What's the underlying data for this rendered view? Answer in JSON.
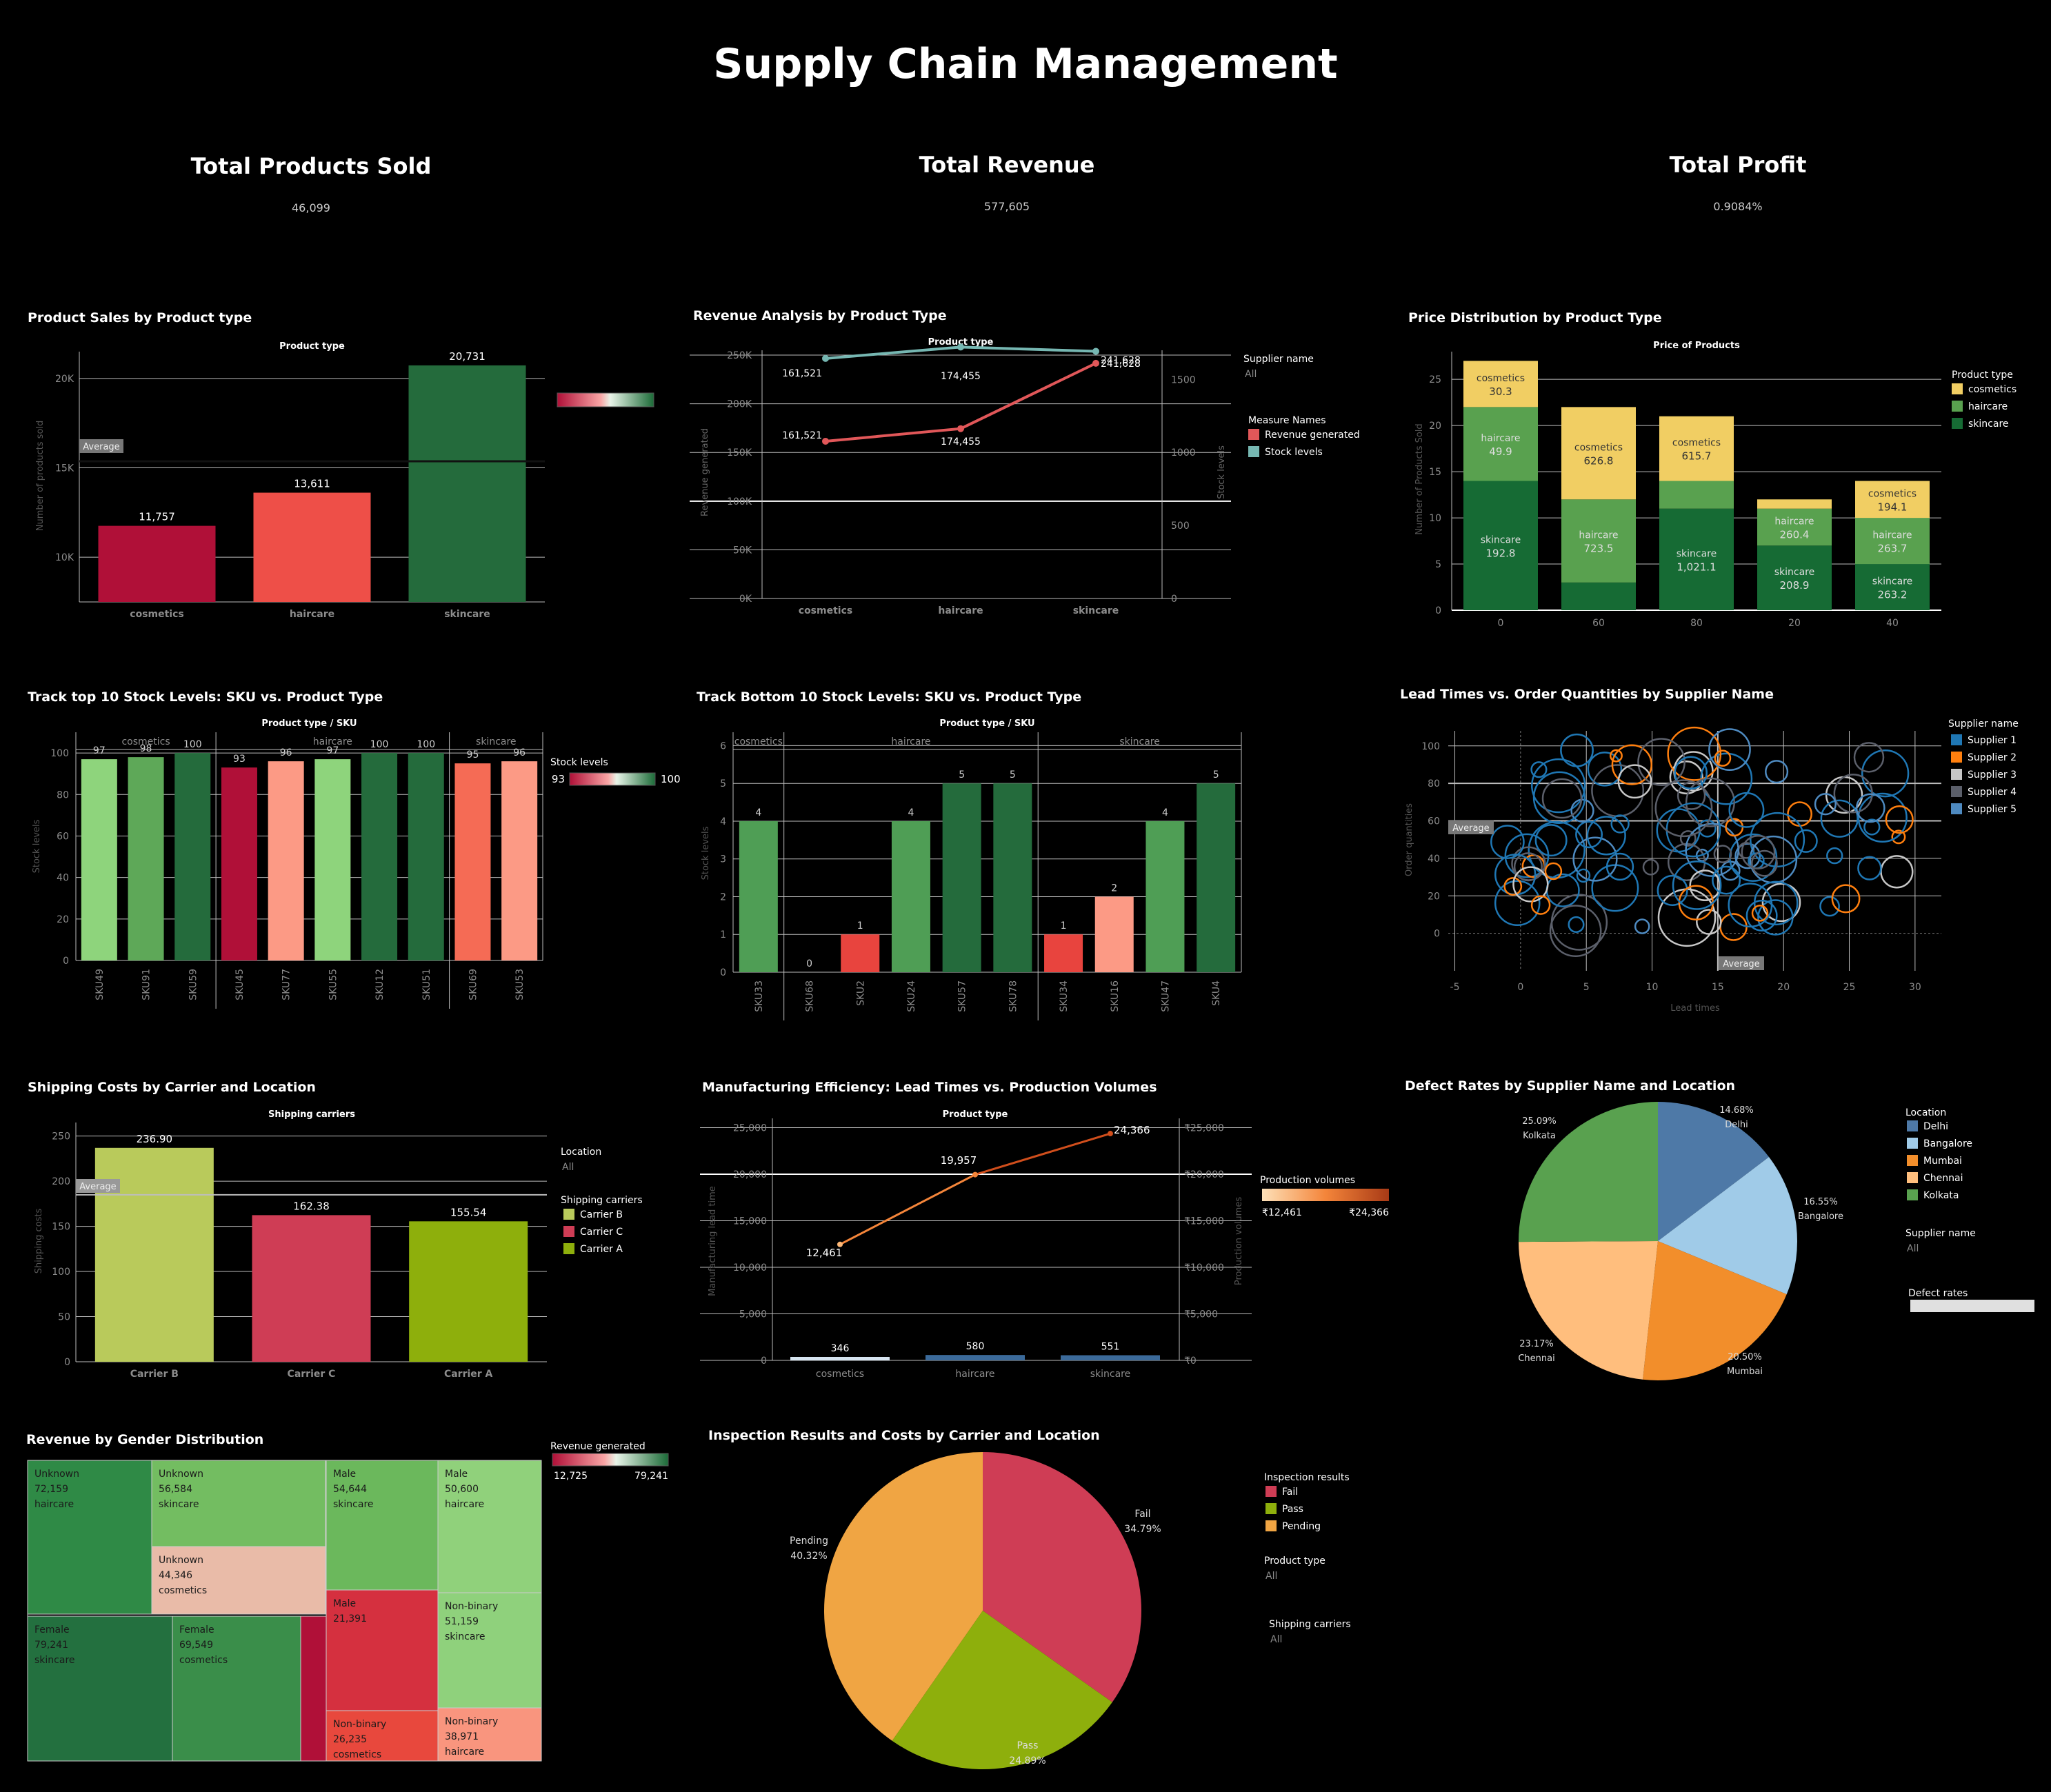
{
  "page_title": "Supply Chain Management",
  "kpis": [
    {
      "title": "Total Products Sold",
      "value": "46,099"
    },
    {
      "title": "Total Revenue",
      "value": "577,605"
    },
    {
      "title": "Total Profit",
      "value": "0.9084%"
    }
  ],
  "chart_data": [
    {
      "id": "product_sales",
      "type": "bar",
      "title": "Product Sales by Product type",
      "header": "Product type",
      "ylabel": "Number of products sold",
      "categories": [
        "cosmetics",
        "haircare",
        "skincare"
      ],
      "values": [
        11757,
        13611,
        20731
      ],
      "value_labels": [
        "11,757",
        "13,611",
        "20,731"
      ],
      "colors": [
        "#b01038",
        "#ee4f48",
        "#246b3c"
      ],
      "yticks": [
        "10K",
        "15K",
        "20K"
      ],
      "ylim": [
        7500,
        21500
      ],
      "reference_line": {
        "label": "Average",
        "value": 15366
      },
      "legend": "color-gradient"
    },
    {
      "id": "revenue_analysis",
      "type": "line",
      "title": "Revenue Analysis by Product Type",
      "header": "Product type",
      "ylabel": "Revenue generated",
      "y2label": "Stock levels",
      "categories": [
        "cosmetics",
        "haircare",
        "skincare"
      ],
      "series": [
        {
          "name": "Revenue generated",
          "color": "#e15759",
          "values": [
            161521,
            174455,
            241628
          ],
          "labels": [
            "161,521",
            "174,455",
            "241,628"
          ]
        },
        {
          "name": "Stock levels",
          "color": "#76b7b2",
          "axis": "right",
          "values": [
            1644,
            1722,
            1693
          ],
          "labels": [
            "161,521",
            "174,455",
            "241,628"
          ]
        }
      ],
      "yticks": [
        "0K",
        "50K",
        "100K",
        "150K",
        "200K",
        "250K"
      ],
      "ylim": [
        0,
        255000
      ],
      "y2ticks": [
        "0",
        "500",
        "1000",
        "1500"
      ],
      "y2lim": [
        0,
        1700
      ],
      "filters": [
        {
          "label": "Supplier name",
          "value": "All"
        }
      ],
      "legend_title": "Measure Names"
    },
    {
      "id": "price_distribution",
      "type": "bar",
      "stacked": true,
      "title": "Price Distribution by Product Type",
      "header": "Price of Products",
      "ylabel": "Number of Products Sold",
      "categories": [
        "0",
        "60",
        "80",
        "20",
        "40"
      ],
      "series": [
        {
          "name": "skincare",
          "color": "#166b34",
          "values": [
            14,
            3,
            11,
            7,
            5
          ],
          "labels": [
            "192.8",
            "",
            "1,021.1",
            "208.9",
            "263.2"
          ]
        },
        {
          "name": "haircare",
          "color": "#59a14f",
          "values": [
            8,
            9,
            3,
            4,
            5
          ],
          "labels": [
            "49.9",
            "723.5",
            "",
            "260.4",
            "263.7"
          ]
        },
        {
          "name": "cosmetics",
          "color": "#f1ce63",
          "values": [
            5,
            10,
            7,
            1,
            4
          ],
          "labels": [
            "30.3",
            "626.8",
            "615.7",
            "",
            "194.1"
          ]
        }
      ],
      "stack_label_names": {
        "skincare": [
          "skincare",
          "",
          "skincare",
          "skincare",
          "skincare"
        ],
        "haircare": [
          "haircare",
          "haircare",
          "",
          "haircare",
          "haircare"
        ],
        "cosmetics": [
          "cosmetics",
          "cosmetics",
          "cosmetics",
          "",
          "cosmetics"
        ]
      },
      "yticks": [
        "0",
        "5",
        "10",
        "15",
        "20",
        "25"
      ],
      "ylim": [
        0,
        28
      ],
      "legend_title": "Product type",
      "legend": [
        "cosmetics",
        "haircare",
        "skincare"
      ]
    },
    {
      "id": "top10_stock",
      "type": "bar",
      "title": "Track top 10 Stock Levels: SKU vs. Product Type",
      "header": "Product type  /  SKU",
      "ylabel": "Stock levels",
      "groups": [
        {
          "name": "cosmetics",
          "skus": [
            "SKU49",
            "SKU91",
            "SKU59"
          ],
          "values": [
            97,
            98,
            100
          ]
        },
        {
          "name": "haircare",
          "skus": [
            "SKU45",
            "SKU77",
            "SKU55",
            "SKU12",
            "SKU51"
          ],
          "values": [
            93,
            96,
            97,
            100,
            100
          ]
        },
        {
          "name": "skincare",
          "skus": [
            "SKU69",
            "SKU53"
          ],
          "values": [
            95,
            96
          ]
        }
      ],
      "colors": [
        "#8ed47c",
        "#5ea858",
        "#246b3c",
        "#b01038",
        "#fc9a85",
        "#8ed47c",
        "#246b3c",
        "#246b3c",
        "#f56b55",
        "#fc9a85"
      ],
      "yticks": [
        "0",
        "20",
        "40",
        "60",
        "80",
        "100"
      ],
      "ylim": [
        0,
        110
      ],
      "legend_title": "Stock levels",
      "legend_min": "93",
      "legend_max": "100"
    },
    {
      "id": "bottom10_stock",
      "type": "bar",
      "title": "Track Bottom 10 Stock Levels: SKU vs. Product Type",
      "header": "Product type  /  SKU",
      "ylabel": "Stock levels",
      "groups": [
        {
          "name": "cosmetics",
          "skus": [
            "SKU33"
          ],
          "values": [
            4
          ]
        },
        {
          "name": "haircare",
          "skus": [
            "SKU68",
            "SKU2",
            "SKU24",
            "SKU57",
            "SKU78"
          ],
          "values": [
            0,
            1,
            4,
            5,
            5
          ]
        },
        {
          "name": "skincare",
          "skus": [
            "SKU34",
            "SKU16",
            "SKU47",
            "SKU4"
          ],
          "values": [
            1,
            2,
            4,
            5
          ]
        }
      ],
      "colors": [
        "#4f9e55",
        "#4f9e55",
        "#e8443e",
        "#4f9e55",
        "#246b3c",
        "#246b3c",
        "#e8443e",
        "#fc9a85",
        "#4f9e55",
        "#246b3c"
      ],
      "yticks": [
        "0",
        "1",
        "2",
        "3",
        "4",
        "5",
        "6"
      ],
      "ylim": [
        0,
        6.3
      ]
    },
    {
      "id": "lead_vs_order",
      "type": "scatter",
      "title": "Lead Times vs. Order Quantities by Supplier Name",
      "xlabel": "Lead times",
      "ylabel": "Order quantities",
      "xticks": [
        "-5",
        "0",
        "5",
        "10",
        "15",
        "20",
        "25",
        "30"
      ],
      "xlim": [
        -5.5,
        32
      ],
      "yticks": [
        "0",
        "20",
        "40",
        "60",
        "80",
        "100"
      ],
      "ylim": [
        -20,
        108
      ],
      "reference_lines": [
        {
          "axis": "y",
          "label": "Average",
          "value": 60
        },
        {
          "axis": "x",
          "label": "Average",
          "value": 15
        }
      ],
      "legend_title": "Supplier name",
      "legend": [
        {
          "name": "Supplier 1",
          "color": "#1f77b4"
        },
        {
          "name": "Supplier 2",
          "color": "#ff7f0e"
        },
        {
          "name": "Supplier 3",
          "color": "#c7c7c7"
        },
        {
          "name": "Supplier 4",
          "color": "#5b5f6a"
        },
        {
          "name": "Supplier 5",
          "color": "#4e8ac0"
        }
      ]
    },
    {
      "id": "shipping_costs",
      "type": "bar",
      "title": "Shipping Costs by Carrier and Location",
      "header": "Shipping carriers",
      "ylabel": "Shipping costs",
      "categories": [
        "Carrier B",
        "Carrier C",
        "Carrier A"
      ],
      "values": [
        236.9,
        162.38,
        155.54
      ],
      "value_labels": [
        "236.90",
        "162.38",
        "155.54"
      ],
      "colors": [
        "#b9ca5b",
        "#cf3d55",
        "#8eaf0c"
      ],
      "yticks": [
        "0",
        "50",
        "100",
        "150",
        "200",
        "250"
      ],
      "ylim": [
        0,
        265
      ],
      "reference_line": {
        "label": "Average",
        "value": 184.94
      },
      "filters": [
        {
          "label": "Location",
          "value": "All"
        }
      ],
      "legend_title": "Shipping carriers"
    },
    {
      "id": "manufacturing_efficiency",
      "type": "line",
      "title": "Manufacturing Efficiency: Lead Times vs. Production Volumes",
      "header": "Product type",
      "ylabel": "Manufacturing lead time",
      "y2label": "Production volumes",
      "categories": [
        "cosmetics",
        "haircare",
        "skincare"
      ],
      "series": [
        {
          "name": "Manufacturing lead time",
          "type": "bar",
          "values": [
            346,
            580,
            551
          ],
          "labels": [
            "346",
            "580",
            "551"
          ]
        },
        {
          "name": "Production volumes",
          "type": "line",
          "values": [
            12461,
            19957,
            24366
          ],
          "labels": [
            "12,461",
            "19,957",
            "24,366"
          ]
        }
      ],
      "yticks": [
        "0",
        "5,000",
        "10,000",
        "15,000",
        "20,000",
        "25,000"
      ],
      "y2ticks": [
        "₹0",
        "₹5,000",
        "₹10,000",
        "₹15,000",
        "₹20,000",
        "₹25,000"
      ],
      "ylim": [
        0,
        26000
      ],
      "legend_title": "Production volumes",
      "legend_min": "₹12,461",
      "legend_max": "₹24,366"
    },
    {
      "id": "defect_rates",
      "type": "pie",
      "title": "Defect Rates by Supplier Name and Location",
      "slices": [
        {
          "name": "Delhi",
          "value": 14.68,
          "label": "14.68%",
          "color": "#4e79a7"
        },
        {
          "name": "Bangalore",
          "value": 16.55,
          "label": "16.55%",
          "color": "#a0cbe8"
        },
        {
          "name": "Mumbai",
          "value": 20.5,
          "label": "20.50%",
          "color": "#f28e2b"
        },
        {
          "name": "Chennai",
          "value": 23.17,
          "label": "23.17%",
          "color": "#ffbe7d"
        },
        {
          "name": "Kolkata",
          "value": 25.09,
          "label": "25.09%",
          "color": "#59a14f"
        }
      ],
      "legend_title": "Location",
      "filters": [
        {
          "label": "Supplier name",
          "value": "All"
        },
        {
          "label": "Defect rates",
          "value": ""
        }
      ]
    },
    {
      "id": "gender_revenue",
      "type": "heatmap",
      "title": "Revenue by Gender Distribution",
      "cells": [
        {
          "gender": "Unknown",
          "value": "72,159",
          "type": "haircare",
          "color": "#2f8a46"
        },
        {
          "gender": "Unknown",
          "value": "56,584",
          "type": "skincare",
          "color": "#73bd61"
        },
        {
          "gender": "Unknown",
          "value": "44,346",
          "type": "cosmetics",
          "color": "#e9bba8"
        },
        {
          "gender": "Female",
          "value": "79,241",
          "type": "skincare",
          "color": "#23703f"
        },
        {
          "gender": "Female",
          "value": "69,549",
          "type": "cosmetics",
          "color": "#3a8e4a"
        },
        {
          "gender": "",
          "value": "",
          "type": "",
          "color": "#b01038"
        },
        {
          "gender": "Male",
          "value": "54,644",
          "type": "skincare",
          "color": "#6bb85c"
        },
        {
          "gender": "Male",
          "value": "50,600",
          "type": "haircare",
          "color": "#90d17b"
        },
        {
          "gender": "Male",
          "value": "21,391",
          "type": "",
          "color": "#d5303f"
        },
        {
          "gender": "Non-binary",
          "value": "51,159",
          "type": "skincare",
          "color": "#8fd17c"
        },
        {
          "gender": "Non-binary",
          "value": "38,971",
          "type": "haircare",
          "color": "#f9957e"
        },
        {
          "gender": "Non-binary",
          "value": "26,235",
          "type": "cosmetics",
          "color": "#e8483d"
        }
      ],
      "legend_title": "Revenue generated",
      "legend_min": "12,725",
      "legend_max": "79,241"
    },
    {
      "id": "inspection",
      "type": "pie",
      "title": "Inspection Results and Costs by Carrier and Location",
      "slices": [
        {
          "name": "Fail",
          "value": 34.79,
          "label": "34.79%",
          "color": "#cf3d55"
        },
        {
          "name": "Pass",
          "value": 24.89,
          "label": "24.89%",
          "color": "#8eaf0c"
        },
        {
          "name": "Pending",
          "value": 40.32,
          "label": "40.32%",
          "color": "#f0a543"
        }
      ],
      "legend_title": "Inspection results",
      "filters": [
        {
          "label": "Product type",
          "value": "All"
        },
        {
          "label": "Shipping carriers",
          "value": "All"
        }
      ]
    }
  ],
  "colors": {
    "grid": "#bdbdbd",
    "axis_text": "#8c8c8c",
    "panel_text": "#ffffff"
  }
}
